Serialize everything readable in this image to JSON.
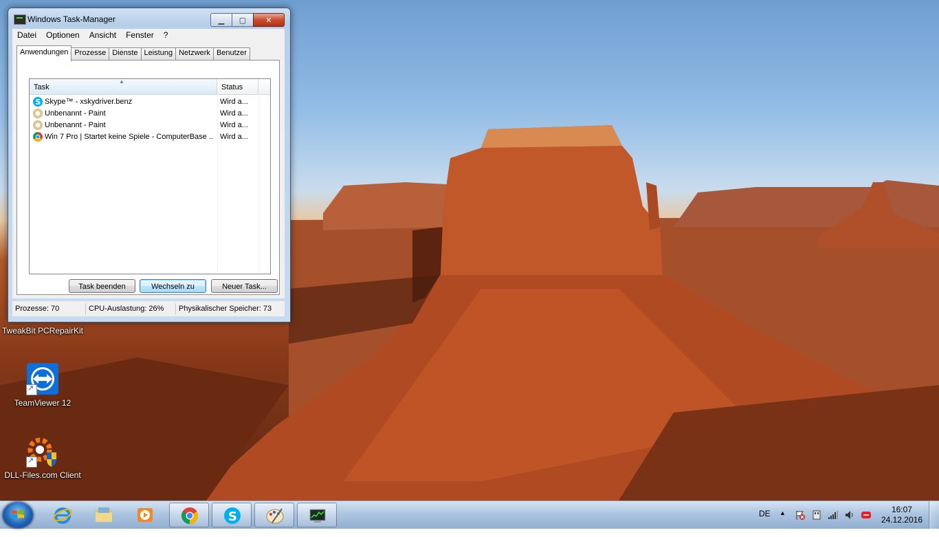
{
  "window": {
    "title": "Windows Task-Manager",
    "menu": [
      "Datei",
      "Optionen",
      "Ansicht",
      "Fenster",
      "?"
    ],
    "tabs": [
      "Anwendungen",
      "Prozesse",
      "Dienste",
      "Leistung",
      "Netzwerk",
      "Benutzer"
    ],
    "active_tab": "Anwendungen",
    "list": {
      "columns": [
        "Task",
        "Status"
      ],
      "rows": [
        {
          "icon": "skype-icon",
          "task": "Skype™ - xskydriver.benz",
          "status": "Wird a..."
        },
        {
          "icon": "paint-icon",
          "task": "Unbenannt - Paint",
          "status": "Wird a..."
        },
        {
          "icon": "paint-icon",
          "task": "Unbenannt - Paint",
          "status": "Wird a..."
        },
        {
          "icon": "chrome-icon",
          "task": "Win 7 Pro | Startet keine Spiele - ComputerBase ...",
          "status": "Wird a..."
        }
      ]
    },
    "buttons": {
      "end_task": "Task beenden",
      "switch_to": "Wechseln zu",
      "new_task": "Neuer Task..."
    },
    "statusbar": {
      "processes": "Prozesse: 70",
      "cpu": "CPU-Auslastung: 26%",
      "memory": "Physikalischer Speicher: 73"
    }
  },
  "desktop_icons": [
    {
      "label": "TweakBit PCRepairKit",
      "icon": "tweakbit-icon"
    },
    {
      "label": "TeamViewer 12",
      "icon": "teamviewer-icon"
    },
    {
      "label": "DLL-Files.com Client",
      "icon": "dll-files-icon"
    }
  ],
  "taskbar": {
    "pinned": [
      "internet-explorer-icon",
      "explorer-folder-icon",
      "media-player-icon",
      "chrome-icon",
      "skype-icon",
      "paint-icon",
      "task-manager-icon"
    ],
    "language": "DE",
    "time": "16:07",
    "date": "24.12.2016"
  },
  "colors": {
    "taskbar": "#a8c2e0",
    "window_frame": "#b7cfe9",
    "close_button": "#c94a2e",
    "skype_blue": "#00aff0"
  }
}
